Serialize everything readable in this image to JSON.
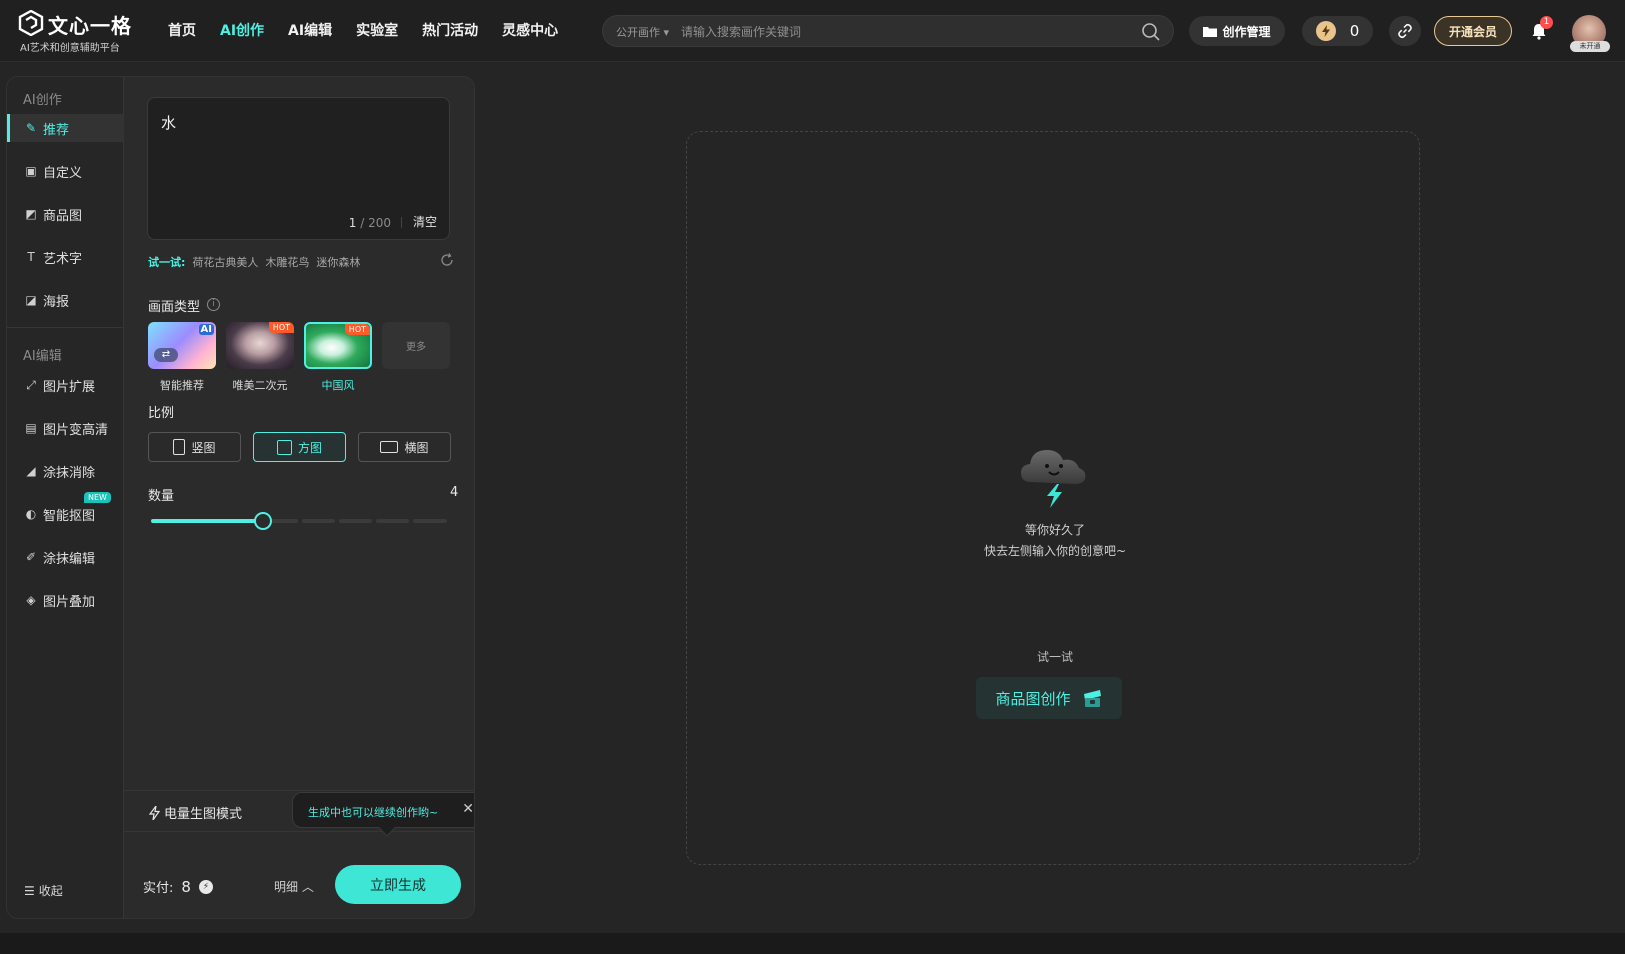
{
  "brand": {
    "name": "文心一格",
    "slogan": "AI艺术和创意辅助平台"
  },
  "nav": [
    {
      "label": "首页"
    },
    {
      "label": "AI创作"
    },
    {
      "label": "AI编辑"
    },
    {
      "label": "实验室"
    },
    {
      "label": "热门活动"
    },
    {
      "label": "灵感中心"
    }
  ],
  "search": {
    "scope": "公开画作",
    "placeholder": "请输入搜索画作关键词"
  },
  "header": {
    "manage_label": "创作管理",
    "credits": "0",
    "vip_label": "开通会员",
    "notification_count": "1",
    "avatar_tag": "未开通"
  },
  "sidebar": {
    "create_title": "AI创作",
    "create_items": [
      {
        "label": "推荐",
        "icon": "brush-icon"
      },
      {
        "label": "自定义",
        "icon": "cube-icon"
      },
      {
        "label": "商品图",
        "icon": "product-icon"
      },
      {
        "label": "艺术字",
        "icon": "text-art-icon"
      },
      {
        "label": "海报",
        "icon": "poster-icon"
      }
    ],
    "edit_title": "AI编辑",
    "edit_items": [
      {
        "label": "图片扩展",
        "icon": "expand-icon"
      },
      {
        "label": "图片变高清",
        "icon": "hd-icon"
      },
      {
        "label": "涂抹消除",
        "icon": "eraser-icon"
      },
      {
        "label": "智能抠图",
        "icon": "cutout-icon",
        "badge": "NEW"
      },
      {
        "label": "涂抹编辑",
        "icon": "paint-edit-icon"
      },
      {
        "label": "图片叠加",
        "icon": "layers-icon"
      }
    ],
    "collapse_label": "收起"
  },
  "prompt": {
    "value": "水",
    "count_current": "1",
    "count_max": "/ 200",
    "clear_label": "清空"
  },
  "try": {
    "label": "试一试:",
    "suggestions": [
      "荷花古典美人",
      "木雕花鸟",
      "迷你森林"
    ]
  },
  "style": {
    "label": "画面类型",
    "options": [
      {
        "label": "智能推荐",
        "badge": "AI"
      },
      {
        "label": "唯美二次元",
        "badge": "HOT"
      },
      {
        "label": "中国风",
        "badge": "HOT",
        "selected": true
      },
      {
        "label": "更多"
      }
    ]
  },
  "ratio": {
    "label": "比例",
    "options": [
      {
        "label": "竖图"
      },
      {
        "label": "方图",
        "selected": true
      },
      {
        "label": "横图"
      }
    ]
  },
  "quantity": {
    "label": "数量",
    "value": 4,
    "min": 1,
    "max": 8
  },
  "mode": {
    "label": "电量生图模式"
  },
  "tooltip": {
    "text": "生成中也可以继续创作哟~"
  },
  "footer": {
    "pay_label": "实付:",
    "pay_amount": "8",
    "detail_label": "明细",
    "generate_label": "立即生成"
  },
  "canvas": {
    "line1": "等你好久了",
    "line2": "快去左侧输入你的创意吧~",
    "try_label": "试一试",
    "try_button": "商品图创作"
  },
  "colors": {
    "accent": "#4df0e2",
    "background": "#252525",
    "panel": "#2b2b2b",
    "hot": "#ff5a2a",
    "vip": "#e8c895"
  }
}
